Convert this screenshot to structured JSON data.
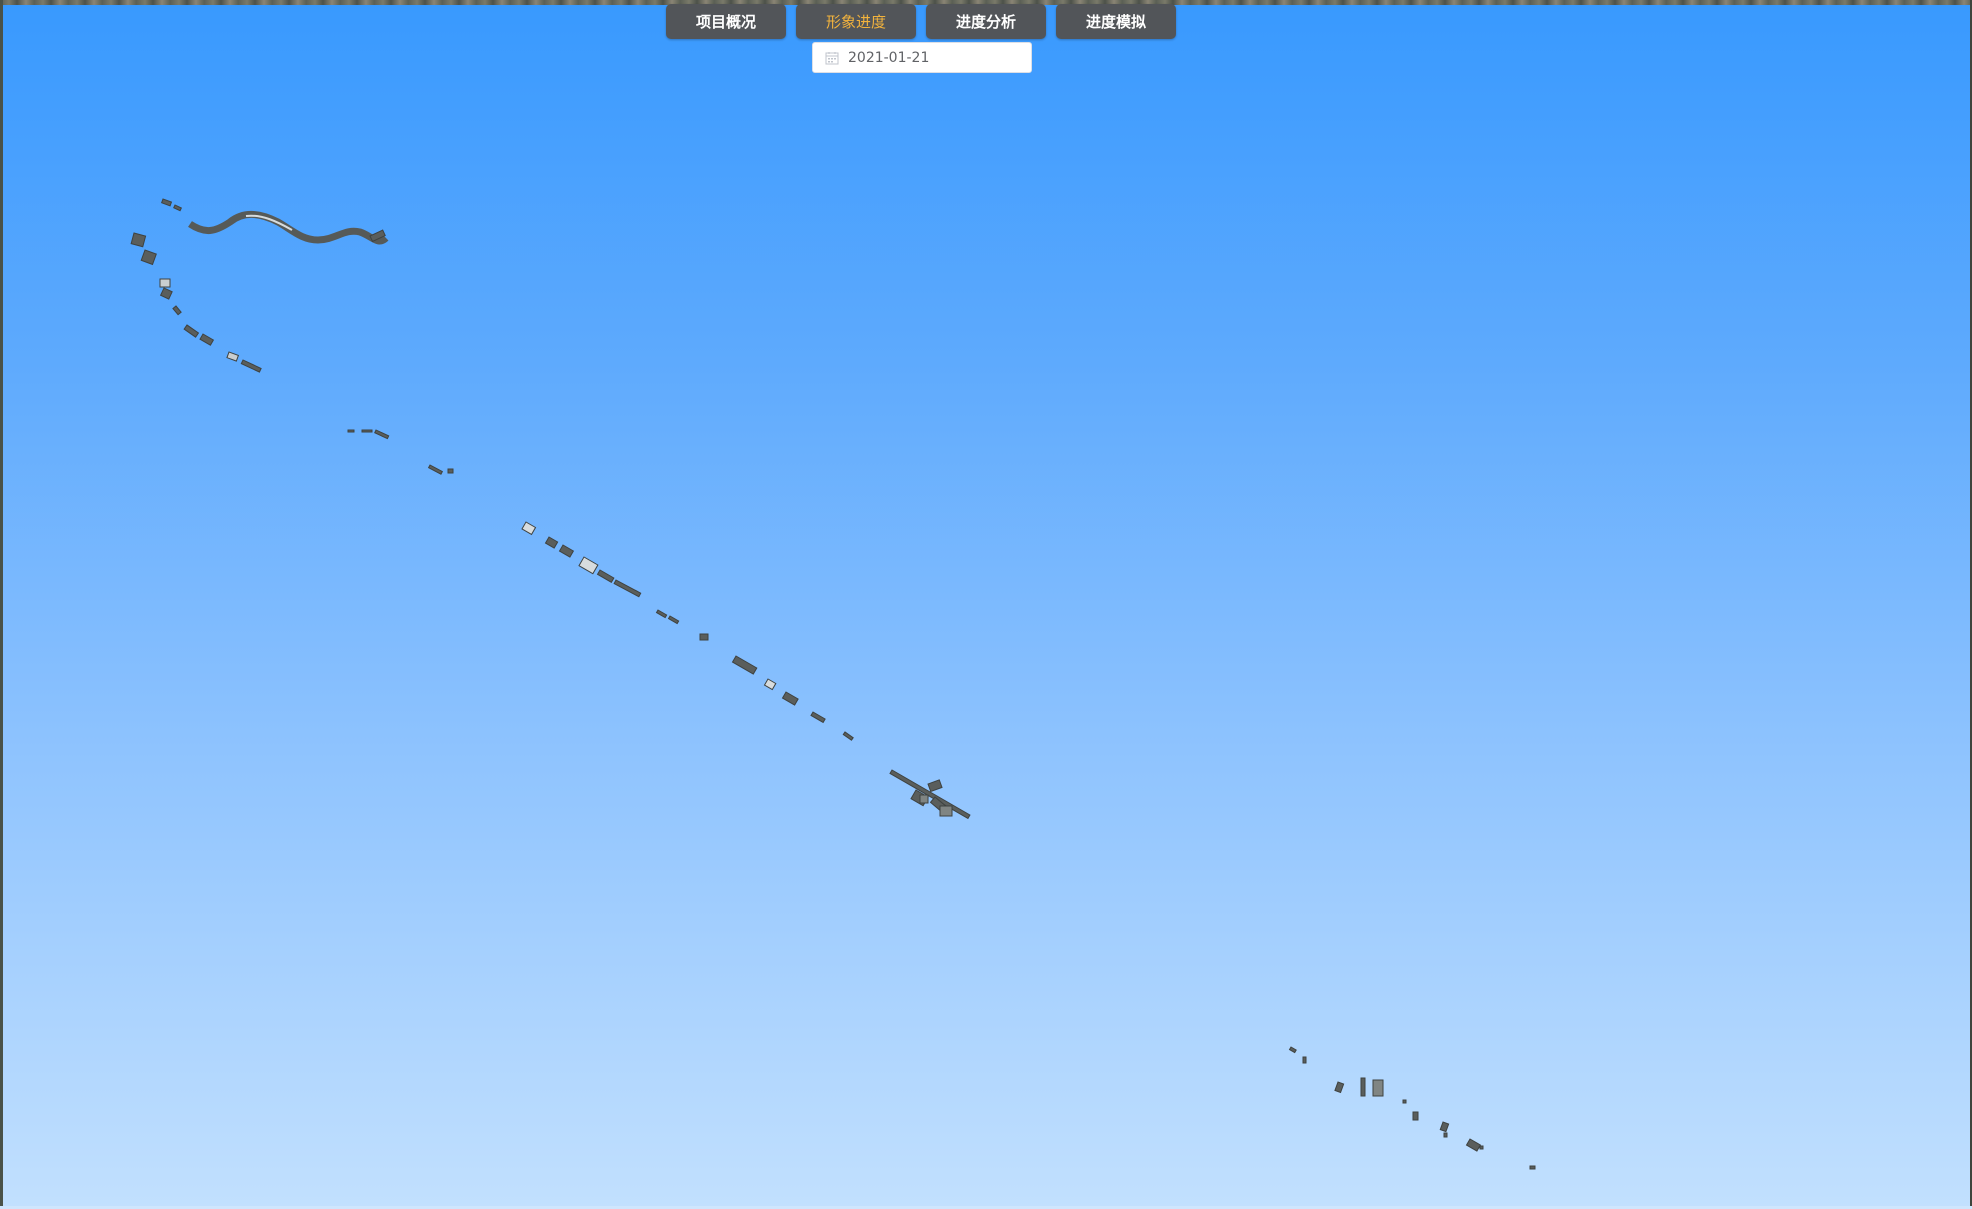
{
  "nav": {
    "tabs": [
      {
        "label": "项目概况",
        "active": false
      },
      {
        "label": "形象进度",
        "active": true
      },
      {
        "label": "进度分析",
        "active": false
      },
      {
        "label": "进度模拟",
        "active": false
      }
    ]
  },
  "date_picker": {
    "value": "2021-01-21",
    "icon": "calendar-icon"
  },
  "scene": {
    "model_color": "#5a5e5c",
    "model_highlight": "#d7dcde",
    "sky_top": "#3899fe",
    "sky_bottom": "#c2e0fe",
    "active_tab_color": "#f2b33d"
  }
}
